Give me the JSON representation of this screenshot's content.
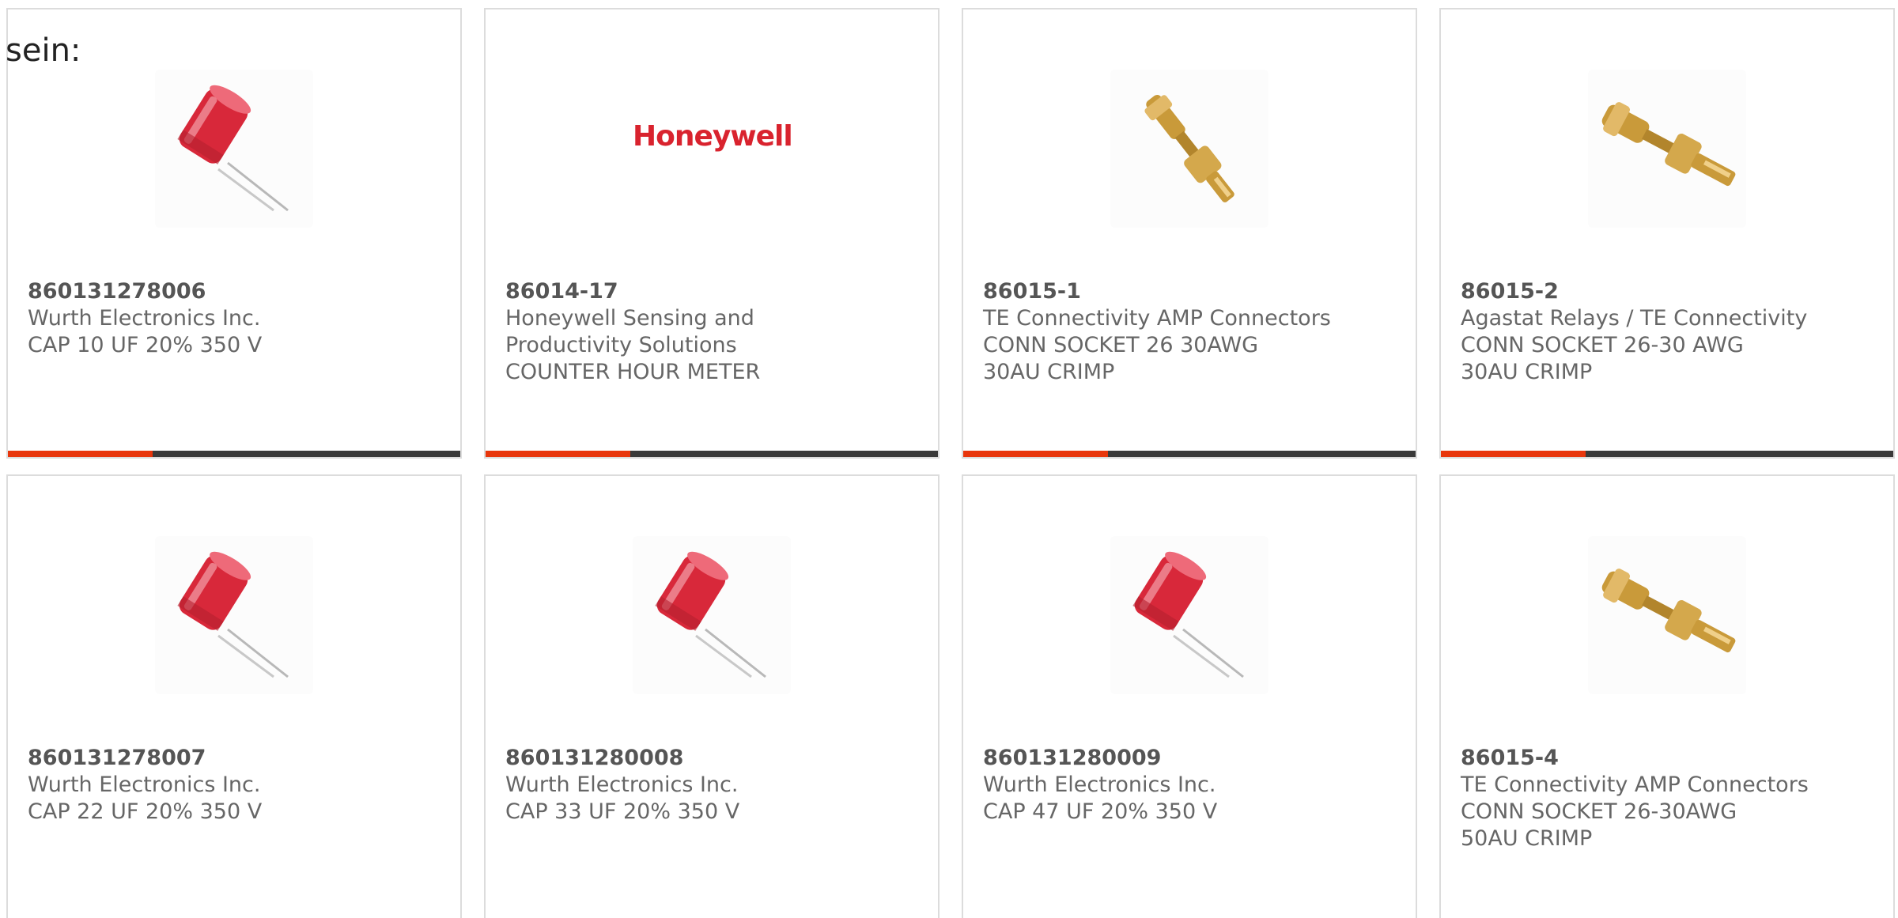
{
  "intro_text": "sein:",
  "colors": {
    "accent": "#e8360c",
    "bar_dark": "#3a3a3a",
    "card_border": "#dcdcdc",
    "capacitor_red": "#d8283a",
    "gold": "#c99a3a",
    "honeywell_red": "#d9232e"
  },
  "products": [
    {
      "part_number": "860131278006",
      "manufacturer": "Wurth Electronics Inc.",
      "description": "CAP 10 UF 20% 350 V",
      "image": "capacitor-image",
      "rating_fraction": 0.32
    },
    {
      "part_number": "86014-17",
      "manufacturer": "Honeywell Sensing and Productivity Solutions",
      "description": "COUNTER HOUR METER",
      "image": "honeywell-logo",
      "logo_text": "Honeywell",
      "rating_fraction": 0.32
    },
    {
      "part_number": "86015-1",
      "manufacturer": "TE Connectivity AMP Connectors",
      "description": "CONN SOCKET 26 30AWG 30AU CRIMP",
      "image": "crimp-socket-image",
      "rating_fraction": 0.32
    },
    {
      "part_number": "86015-2",
      "manufacturer": "Agastat Relays / TE Connectivity",
      "description": "CONN SOCKET 26-30 AWG 30AU CRIMP",
      "image": "crimp-socket-image",
      "rating_fraction": 0.32
    },
    {
      "part_number": "860131278007",
      "manufacturer": "Wurth Electronics Inc.",
      "description": "CAP 22 UF 20% 350 V",
      "image": "capacitor-image"
    },
    {
      "part_number": "860131280008",
      "manufacturer": "Wurth Electronics Inc.",
      "description": "CAP 33 UF 20% 350 V",
      "image": "capacitor-image"
    },
    {
      "part_number": "860131280009",
      "manufacturer": "Wurth Electronics Inc.",
      "description": "CAP 47 UF 20% 350 V",
      "image": "capacitor-image"
    },
    {
      "part_number": "86015-4",
      "manufacturer": "TE Connectivity AMP Connectors",
      "description": "CONN SOCKET 26-30AWG 50AU CRIMP",
      "image": "crimp-socket-image"
    }
  ]
}
